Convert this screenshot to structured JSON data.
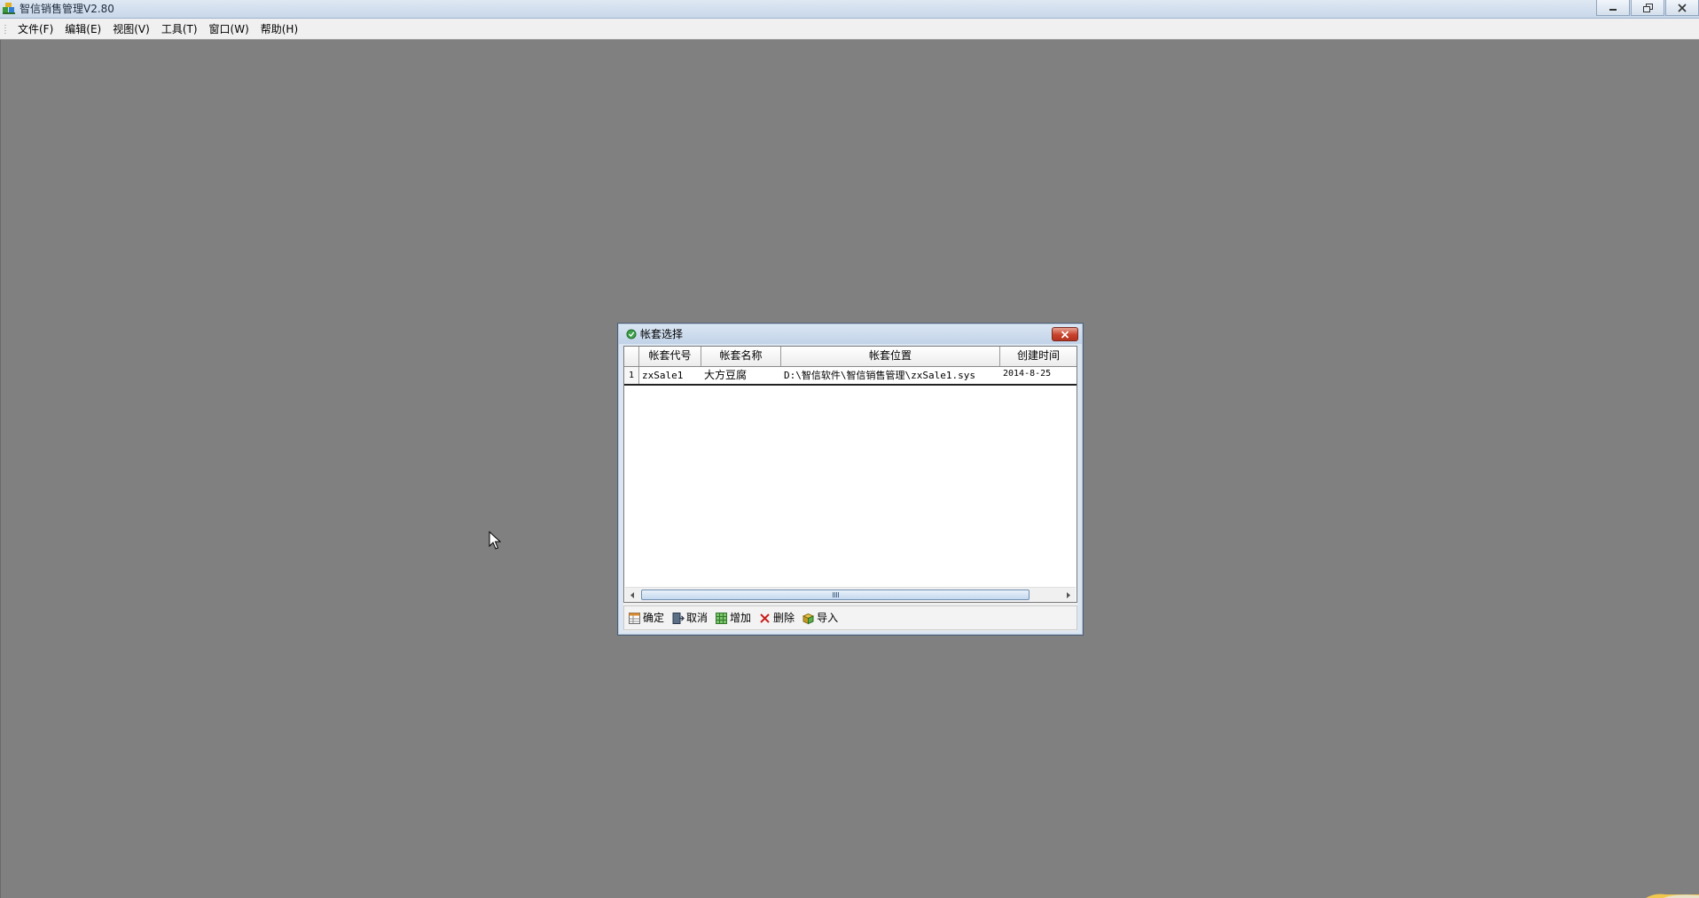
{
  "app": {
    "title": "智信销售管理V2.80"
  },
  "menubar": {
    "items": [
      "文件(F)",
      "编辑(E)",
      "视图(V)",
      "工具(T)",
      "窗口(W)",
      "帮助(H)"
    ]
  },
  "dialog": {
    "title": "帐套选择",
    "grid": {
      "columns": [
        "帐套代号",
        "帐套名称",
        "帐套位置",
        "创建时间"
      ],
      "rows": [
        {
          "row_number": "1",
          "code": "zxSale1",
          "name": "大方豆腐",
          "path": "D:\\智信软件\\智信销售管理\\zxSale1.sys",
          "created": "2014-8-25"
        }
      ]
    },
    "buttons": {
      "ok": "确定",
      "cancel": "取消",
      "add": "增加",
      "delete": "删除",
      "import": "导入"
    }
  },
  "colors": {
    "mdi_background": "#808080",
    "close_button": "#c7422b",
    "title_gradient_top": "#dfe8f3"
  }
}
